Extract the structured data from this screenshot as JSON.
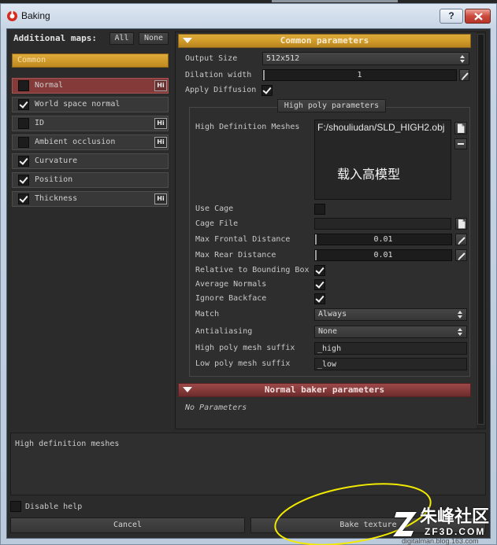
{
  "window": {
    "title": "Baking",
    "help_button": "?"
  },
  "left_panel": {
    "additional_maps_label": "Additional maps:",
    "all_button": "All",
    "none_button": "None",
    "group_label": "Common",
    "high_poly_badge": "Hi",
    "maps": [
      {
        "label": "Normal",
        "checked": false,
        "high_poly": true,
        "selected": true
      },
      {
        "label": "World space normal",
        "checked": true,
        "high_poly": false,
        "selected": false
      },
      {
        "label": "ID",
        "checked": false,
        "high_poly": true,
        "selected": false
      },
      {
        "label": "Ambient occlusion",
        "checked": false,
        "high_poly": true,
        "selected": false
      },
      {
        "label": "Curvature",
        "checked": true,
        "high_poly": false,
        "selected": false
      },
      {
        "label": "Position",
        "checked": true,
        "high_poly": false,
        "selected": false
      },
      {
        "label": "Thickness",
        "checked": true,
        "high_poly": true,
        "selected": false
      }
    ]
  },
  "common_parameters": {
    "header": "Common parameters",
    "output_size": {
      "label": "Output Size",
      "value": "512x512"
    },
    "dilation_width": {
      "label": "Dilation width",
      "value": "1"
    },
    "apply_diffusion": {
      "label": "Apply Diffusion",
      "checked": true
    }
  },
  "high_poly_parameters": {
    "tab_label": "High poly parameters",
    "high_definition_meshes": {
      "label": "High Definition Meshes",
      "files": [
        "F:/shouliudan/SLD_HIGH2.obj"
      ]
    },
    "use_cage": {
      "label": "Use Cage",
      "checked": false
    },
    "cage_file": {
      "label": "Cage File"
    },
    "max_frontal_distance": {
      "label": "Max Frontal Distance",
      "value": "0.01"
    },
    "max_rear_distance": {
      "label": "Max Rear Distance",
      "value": "0.01"
    },
    "relative_to_bounding_box": {
      "label": "Relative to Bounding Box",
      "checked": true
    },
    "average_normals": {
      "label": "Average Normals",
      "checked": true
    },
    "ignore_backface": {
      "label": "Ignore Backface",
      "checked": true
    },
    "match": {
      "label": "Match",
      "value": "Always"
    },
    "antialiasing": {
      "label": "Antialiasing",
      "value": "None"
    },
    "high_poly_mesh_suffix": {
      "label": "High poly mesh suffix",
      "value": "_high"
    },
    "low_poly_mesh_suffix": {
      "label": "Low poly mesh suffix",
      "value": "_low"
    }
  },
  "normal_baker_parameters": {
    "header": "Normal baker parameters",
    "empty_text": "No Parameters"
  },
  "help": {
    "text": "High definition meshes",
    "disable_label": "Disable help",
    "disable_checked": false
  },
  "footer": {
    "cancel_button": "Cancel",
    "bake_button": "Bake texture"
  },
  "annotation": {
    "mesh_note": "载入高模型"
  },
  "watermark": {
    "brand": "朱峰社区",
    "site": "ZF3D.COM",
    "blog": "digitalman.blog.163.com"
  },
  "colors": {
    "gold": "#d09b29",
    "red": "#853a3a",
    "panel": "#2b2b2b",
    "text": "#c8c8c8",
    "annotation": "#f2ea00"
  }
}
